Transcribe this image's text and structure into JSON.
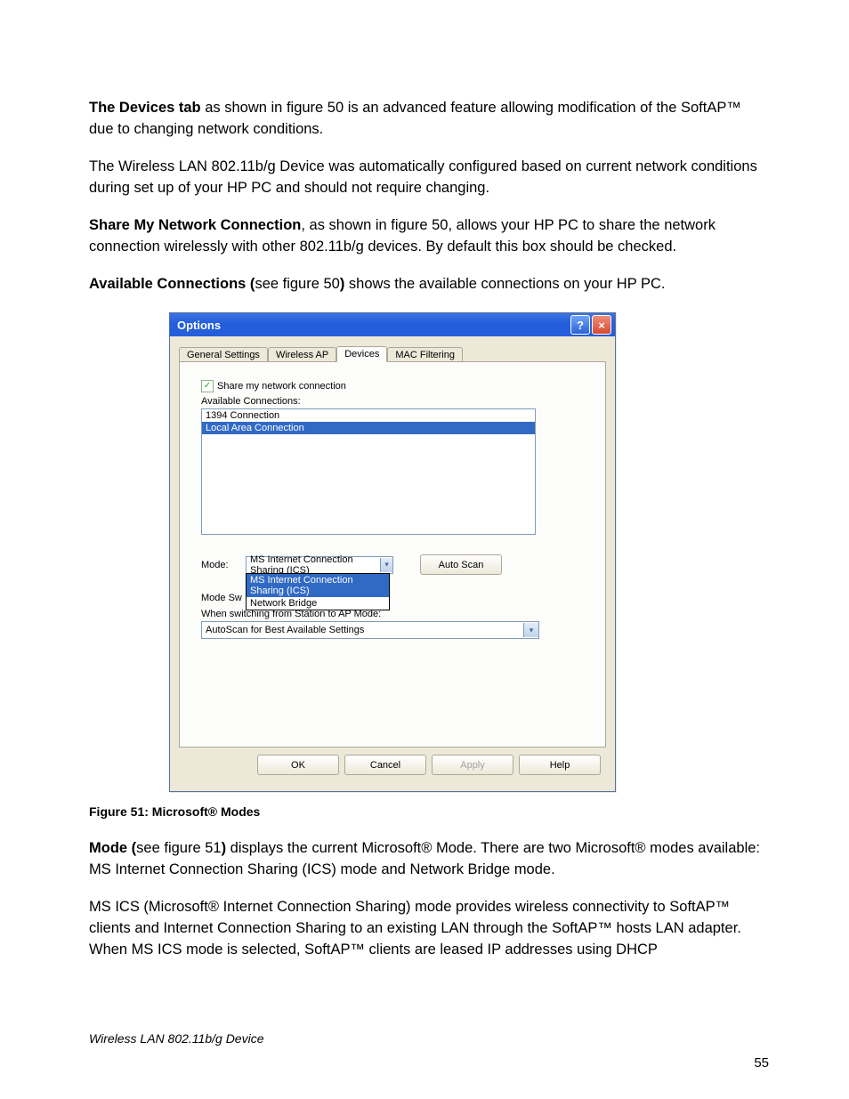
{
  "paragraphs": {
    "p1_bold": "The Devices tab",
    "p1_rest": " as shown in figure 50 is an advanced feature allowing modification of the SoftAP™  due to changing network conditions.",
    "p2": " The Wireless LAN 802.11b/g Device was automatically configured based on current network conditions during set up of your HP PC and should not require changing.",
    "p3_bold": "Share My Network Connection",
    "p3_rest": ", as shown in figure 50, allows your HP PC to share the network connection wirelessly with other 802.11b/g devices. By default this box should be checked.",
    "p4_bold": "Available Connections (",
    "p4_mid": "see figure 50",
    "p4_bold2": ")",
    "p4_rest": " shows the available connections on your HP PC.",
    "caption": "Figure 51: Microsoft® Modes",
    "p5_bold": "Mode (",
    "p5_mid": "see figure 51",
    "p5_bold2": ")",
    "p5_rest": " displays the current Microsoft® Mode.  There are two Microsoft® modes available: MS Internet Connection Sharing (ICS) mode and Network Bridge mode.",
    "p6": "MS ICS (Microsoft® Internet Connection Sharing) mode provides wireless connectivity to SoftAP™ clients and Internet Connection Sharing to an existing LAN through the SoftAP™  hosts LAN adapter.  When MS ICS mode is selected, SoftAP™  clients are leased IP addresses using DHCP"
  },
  "dialog": {
    "title": "Options",
    "tabs": [
      "General Settings",
      "Wireless AP",
      "Devices",
      "MAC Filtering"
    ],
    "active_tab_index": 2,
    "share_label": "Share my network connection",
    "available_label": "Available Connections:",
    "connections": [
      "1394 Connection",
      "Local Area Connection"
    ],
    "selected_connection_index": 1,
    "mode_label": "Mode:",
    "mode_value": "MS Internet Connection Sharing (ICS)",
    "mode_options": [
      "MS Internet Connection Sharing (ICS)",
      "Network Bridge"
    ],
    "mode_selected_option_index": 0,
    "auto_scan_btn": "Auto Scan",
    "mode_sw_prefix": "Mode Sw",
    "switch_label": "When switching from Station to AP Mode:",
    "switch_value": "AutoScan for Best Available Settings",
    "buttons": {
      "ok": "OK",
      "cancel": "Cancel",
      "apply": "Apply",
      "help": "Help"
    }
  },
  "footer": "Wireless LAN 802.11b/g Device",
  "page_number": "55"
}
